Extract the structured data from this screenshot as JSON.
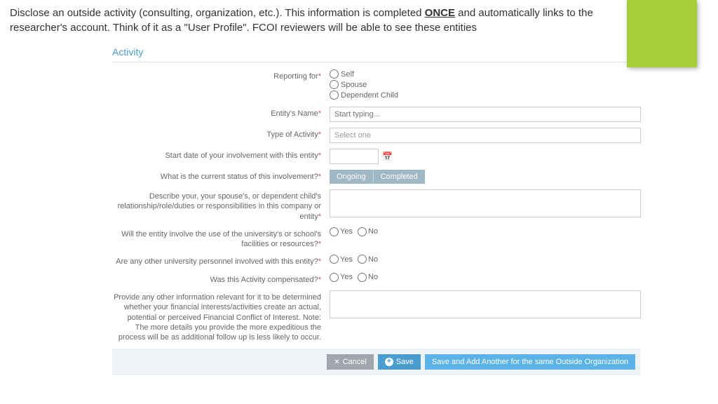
{
  "instructions": {
    "part1": "Disclose an outside activity (consulting, organization, etc.). This information is completed ",
    "once": "ONCE",
    "part2": " and automatically links to the researcher's account. Think of it as a \"User Profile\". FCOI reviewers will be able to see these entities"
  },
  "section_title": "Activity",
  "fields": {
    "reporting_for": {
      "label": "Reporting for",
      "options": [
        "Self",
        "Spouse",
        "Dependent Child"
      ]
    },
    "entity_name": {
      "label": "Entity's Name",
      "placeholder": "Start typing..."
    },
    "type_activity": {
      "label": "Type of Activity",
      "placeholder": "Select one"
    },
    "start_date": {
      "label": "Start date of your involvement with this entity"
    },
    "status": {
      "label": "What is the current status of this involvement?",
      "options": [
        "Ongoing",
        "Completed"
      ]
    },
    "describe": {
      "label": "Describe your, your spouse's, or dependent child's relationship/role/duties or responsibilities in this company or entity"
    },
    "facilities": {
      "label": "Will the entity involve the use of the university's or school's facilities or resources?"
    },
    "personnel": {
      "label": "Are any other university personnel involved with this entity?"
    },
    "compensated": {
      "label": "Was this Activity compensated?"
    },
    "other_info": {
      "label": "Provide any other information relevant for it to be determined whether your financial interests/activities create an actual, potential or perceived Financial Conflict of Interest. Note: The more details you provide the more expeditious the process will be as additional follow up is less likely to occur."
    }
  },
  "yesno": {
    "yes": "Yes",
    "no": "No"
  },
  "buttons": {
    "cancel": "Cancel",
    "save": "Save",
    "save_another": "Save and Add Another for the same Outside Organization"
  }
}
